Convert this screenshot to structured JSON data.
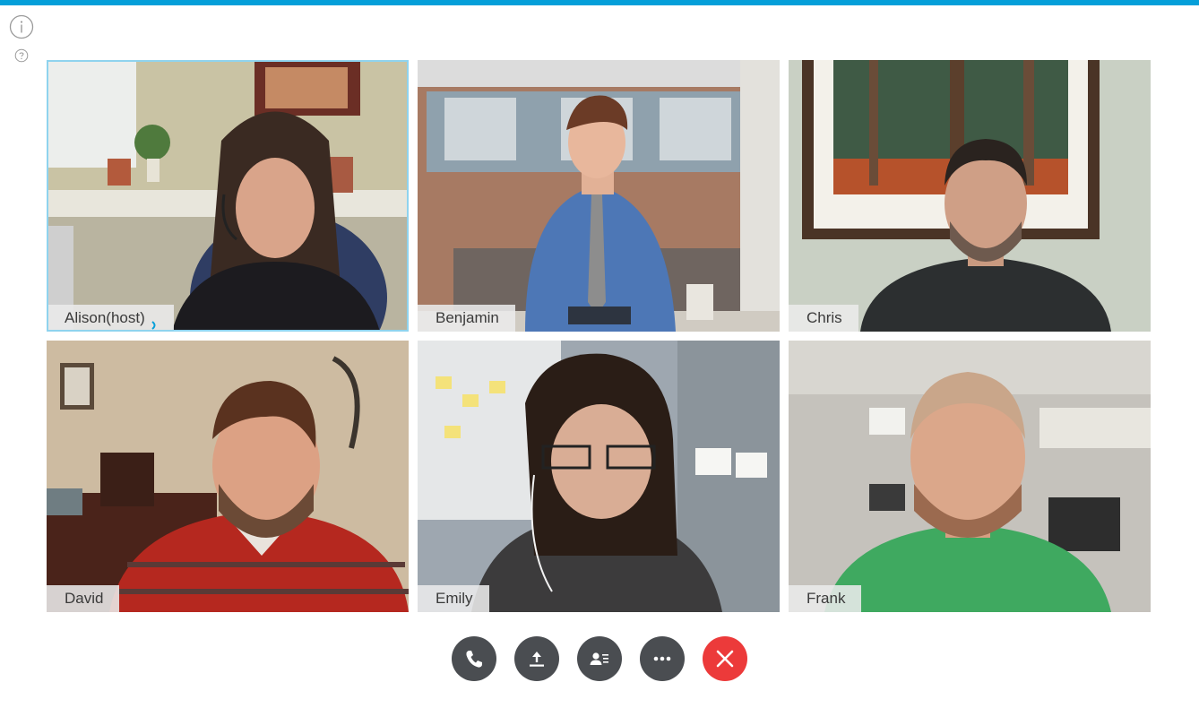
{
  "colors": {
    "accent_bar": "#049fd9",
    "active_border": "#8fd3ee",
    "control_bg": "#4a4d51",
    "end_call_bg": "#ec3a3a"
  },
  "header": {
    "info_icon": "info-icon",
    "help_icon": "question-icon"
  },
  "participants": [
    {
      "name": "Alison(host)",
      "active_speaker": true
    },
    {
      "name": "Benjamin",
      "active_speaker": false
    },
    {
      "name": "Chris",
      "active_speaker": false
    },
    {
      "name": "David",
      "active_speaker": false
    },
    {
      "name": "Emily",
      "active_speaker": false
    },
    {
      "name": "Frank",
      "active_speaker": false
    }
  ],
  "controls": [
    {
      "icon": "phone-icon"
    },
    {
      "icon": "share-upload-icon"
    },
    {
      "icon": "participants-list-icon"
    },
    {
      "icon": "more-ellipsis-icon"
    },
    {
      "icon": "end-call-x-icon"
    }
  ]
}
